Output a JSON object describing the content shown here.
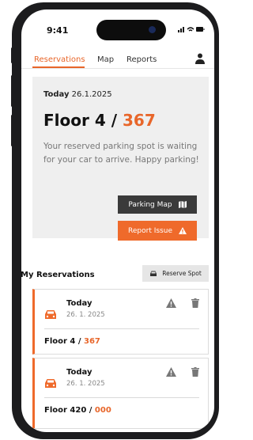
{
  "status": {
    "time": "9:41",
    "system_icons": "signal-wifi-battery"
  },
  "nav": {
    "tabs": [
      {
        "label": "Reservations",
        "active": true
      },
      {
        "label": "Map",
        "active": false
      },
      {
        "label": "Reports",
        "active": false
      }
    ],
    "user_icon": "user-icon"
  },
  "current": {
    "day": "Today",
    "date": "26.1.2025",
    "floor_prefix": "Floor 4 / ",
    "spot": "367",
    "message": "Your reserved parking spot is waiting for your car to arrive. Happy parking!",
    "map_button": "Parking Map",
    "issue_button": "Report Issue"
  },
  "reservations": {
    "title": "My Reservations",
    "reserve_button": "Reserve Spot",
    "items": [
      {
        "day": "Today",
        "date": "26. 1. 2025",
        "floor_prefix": "Floor 4 / ",
        "spot": "367"
      },
      {
        "day": "Today",
        "date": "26. 1. 2025",
        "floor_prefix": "Floor 420 / ",
        "spot": "000"
      }
    ]
  },
  "colors": {
    "accent": "#e8662a",
    "dark_button": "#3a3a3a",
    "card_bg": "#efefef"
  }
}
